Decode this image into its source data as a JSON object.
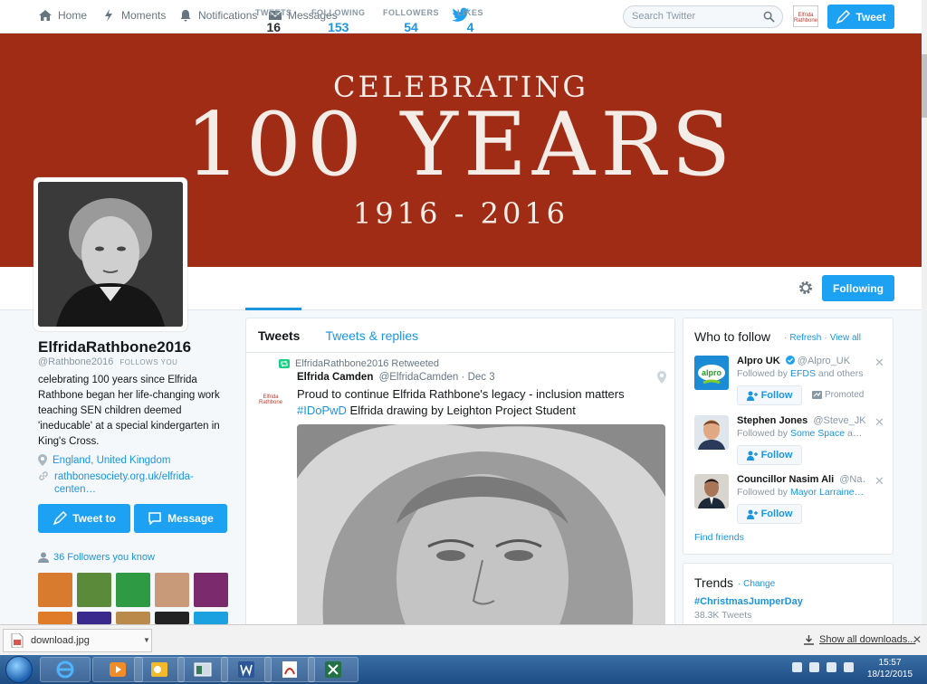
{
  "topnav": {
    "items": [
      {
        "label": "Home",
        "icon": "home-icon"
      },
      {
        "label": "Moments",
        "icon": "lightning-icon"
      },
      {
        "label": "Notifications",
        "icon": "bell-icon"
      },
      {
        "label": "Messages",
        "icon": "envelope-icon"
      }
    ],
    "search_placeholder": "Search Twitter",
    "mini_avatar_text": "Elfrida Rathbone",
    "tweet_label": "Tweet"
  },
  "banner": {
    "line1": "CELEBRATING",
    "line2": "100 YEARS",
    "line3": "1916 - 2016",
    "color": "#a12c16"
  },
  "stats": [
    {
      "label": "TWEETS",
      "value": "16"
    },
    {
      "label": "FOLLOWING",
      "value": "153"
    },
    {
      "label": "FOLLOWERS",
      "value": "54"
    },
    {
      "label": "LIKES",
      "value": "4"
    }
  ],
  "following_label": "Following",
  "profile": {
    "name": "ElfridaRathbone2016",
    "handle": "@Rathbone2016",
    "follows_you": "FOLLOWS YOU",
    "bio": "celebrating 100 years since Elfrida Rathbone began her life-changing work teaching SEN children deemed 'ineducable' at a special kindergarten in King's Cross.",
    "location": "England, United Kingdom",
    "url": "rathbonesociety.org.uk/elfrida-centen…",
    "tweet_to": "Tweet to",
    "message": "Message",
    "followers_you_know": "36 Followers you know"
  },
  "timeline": {
    "tabs": [
      "Tweets",
      "Tweets & replies"
    ],
    "tweet": {
      "retweeted_by": "ElfridaRathbone2016 Retweeted",
      "avatar_text": "Elfrida Rathbone",
      "author": "Elfrida Camden",
      "handle": "@ElfridaCamden",
      "date": "Dec 3",
      "text_before": "Proud to continue Elfrida Rathbone's legacy - inclusion matters",
      "hashtag": "#IDoPwD",
      "text_after": " Elfrida drawing by Leighton Project Student"
    }
  },
  "who_to_follow": {
    "title": "Who to follow",
    "refresh": "Refresh",
    "view_all": "View all",
    "suggestions": [
      {
        "name": "Alpro UK",
        "handle": "@Alpro_UK",
        "followed_by_prefix": "Followed by ",
        "followed_by": "EFDS",
        "suffix": " and others",
        "follow": "Follow",
        "promoted": "Promoted",
        "avatar_text": "alpro"
      },
      {
        "name": "Stephen Jones",
        "handle": "@Steve_JK…",
        "followed_by_prefix": "Followed by ",
        "followed_by": "Some Space",
        "suffix": " a…",
        "follow": "Follow"
      },
      {
        "name": "Councillor Nasim Ali",
        "handle": "@Na…",
        "followed_by_prefix": "Followed by ",
        "followed_by": "Mayor Larraine…",
        "suffix": "",
        "follow": "Follow"
      }
    ],
    "find_friends": "Find friends"
  },
  "trends": {
    "title": "Trends",
    "change": "Change",
    "tag": "#ChristmasJumperDay",
    "count": "38.3K Tweets"
  },
  "downloads": {
    "file": "download.jpg",
    "show_all": "Show all downloads..."
  },
  "taskbar": {
    "time": "15:57",
    "date": "18/12/2015"
  },
  "colors": {
    "accent": "#1da1f2",
    "link": "#1b95e0"
  }
}
